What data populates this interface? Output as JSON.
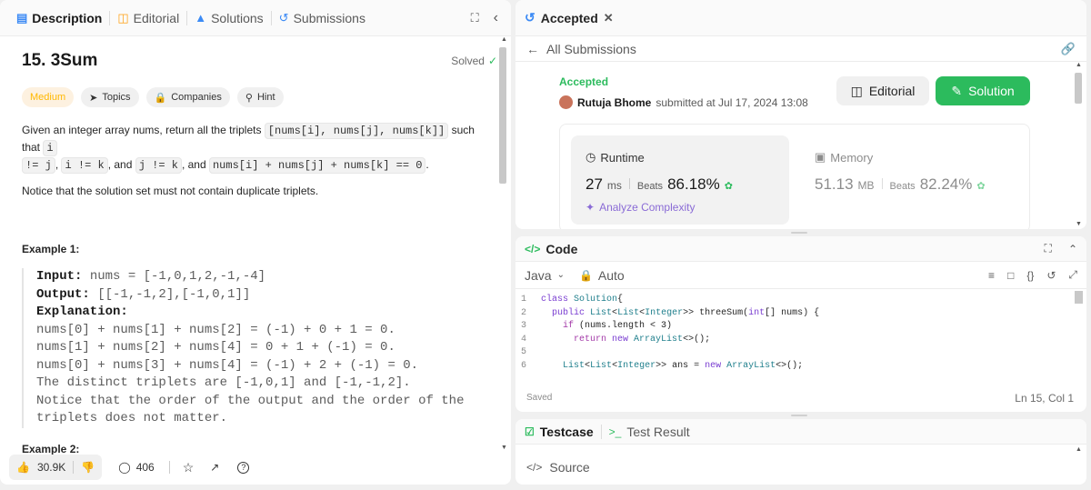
{
  "left": {
    "tabs": [
      {
        "label": "Description",
        "icon": "description-icon"
      },
      {
        "label": "Editorial",
        "icon": "book-icon"
      },
      {
        "label": "Solutions",
        "icon": "flask-icon"
      },
      {
        "label": "Submissions",
        "icon": "history-icon"
      }
    ],
    "title": "15. 3Sum",
    "solved": "Solved",
    "tags": {
      "difficulty": "Medium",
      "topics": "Topics",
      "companies": "Companies",
      "hint": "Hint"
    },
    "desc": {
      "p1a": "Given an integer array nums, return all the triplets ",
      "c1": "[nums[i], nums[j], nums[k]]",
      "p1b": " such that ",
      "c2": "i",
      "c3": "!= j",
      "p1c": ", ",
      "c4": "i != k",
      "p1d": ", and ",
      "c5": "j != k",
      "p1e": ", and ",
      "c6": "nums[i] + nums[j] + nums[k] == 0",
      "p1f": ".",
      "p2": "Notice that the solution set must not contain duplicate triplets."
    },
    "example1": {
      "heading": "Example 1:",
      "input_label": "Input:",
      "input_value": " nums = [-1,0,1,2,-1,-4]",
      "output_label": "Output:",
      "output_value": " [[-1,-1,2],[-1,0,1]]",
      "explanation_label": "Explanation:",
      "lines": [
        "nums[0] + nums[1] + nums[2] = (-1) + 0 + 1 = 0.",
        "nums[1] + nums[2] + nums[4] = 0 + 1 + (-1) = 0.",
        "nums[0] + nums[3] + nums[4] = (-1) + 2 + (-1) = 0.",
        "The distinct triplets are [-1,0,1] and [-1,-1,2].",
        "Notice that the order of the output and the order of the",
        "triplets does not matter."
      ]
    },
    "example2_heading": "Example 2:",
    "footer": {
      "likes": "30.9K",
      "comments": "406"
    }
  },
  "accepted_panel": {
    "tab_label": "Accepted",
    "back_label": "All Submissions",
    "status": "Accepted",
    "user": "Rutuja Bhome",
    "submitted_text": "submitted at Jul 17, 2024 13:08",
    "editorial_btn": "Editorial",
    "solution_btn": "Solution",
    "runtime": {
      "label": "Runtime",
      "value": "27",
      "unit": "ms",
      "beats_label": "Beats",
      "beats": "86.18%"
    },
    "memory": {
      "label": "Memory",
      "value": "51.13",
      "unit": "MB",
      "beats_label": "Beats",
      "beats": "82.24%"
    },
    "analyze": "Analyze Complexity"
  },
  "code_panel": {
    "title": "Code",
    "language": "Java",
    "mode": "Auto",
    "saved": "Saved",
    "position": "Ln 15, Col 1",
    "lines": [
      {
        "num": "1",
        "indent": "",
        "parts": [
          [
            "kw",
            "class "
          ],
          [
            "cls",
            "Solution"
          ],
          [
            "",
            "{"
          ]
        ]
      },
      {
        "num": "2",
        "indent": "  ",
        "parts": [
          [
            "kw",
            "public "
          ],
          [
            "cls",
            "List"
          ],
          [
            "",
            "<"
          ],
          [
            "cls",
            "List"
          ],
          [
            "",
            "<"
          ],
          [
            "cls",
            "Integer"
          ],
          [
            "",
            ">> "
          ],
          [
            "",
            "threeSum("
          ],
          [
            "kw",
            "int"
          ],
          [
            "",
            "[] nums) {"
          ]
        ]
      },
      {
        "num": "3",
        "indent": "    ",
        "parts": [
          [
            "ctl",
            "if "
          ],
          [
            "",
            "(nums.length < 3)"
          ]
        ]
      },
      {
        "num": "4",
        "indent": "      ",
        "parts": [
          [
            "ctl",
            "return "
          ],
          [
            "kw",
            "new "
          ],
          [
            "cls",
            "ArrayList"
          ],
          [
            "",
            "<>();"
          ]
        ]
      },
      {
        "num": "5",
        "indent": "",
        "parts": []
      },
      {
        "num": "6",
        "indent": "    ",
        "parts": [
          [
            "cls",
            "List"
          ],
          [
            "",
            "<"
          ],
          [
            "cls",
            "List"
          ],
          [
            "",
            "<"
          ],
          [
            "cls",
            "Integer"
          ],
          [
            "",
            ">> ans = "
          ],
          [
            "kw",
            "new "
          ],
          [
            "cls",
            "ArrayList"
          ],
          [
            "",
            "<>();"
          ]
        ]
      }
    ]
  },
  "test_panel": {
    "testcase": "Testcase",
    "test_result": "Test Result",
    "source": "Source"
  },
  "colors": {
    "accent_green": "#2cbb5d",
    "medium": "#ffb800",
    "link_blue": "#3b8af5",
    "purple": "#8a6bd6"
  }
}
